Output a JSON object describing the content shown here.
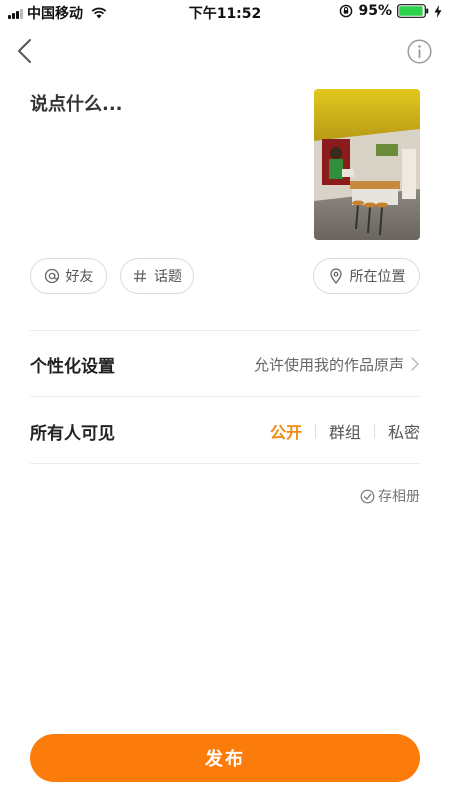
{
  "status_bar": {
    "carrier": "中国移动",
    "time": "下午11:52",
    "battery_percent": "95%",
    "battery_level": 0.95
  },
  "nav": {
    "back_icon": "chevron-left-icon",
    "info_icon": "info-icon"
  },
  "compose": {
    "placeholder": "说点什么...",
    "cover_image": "cafe-interior-photo"
  },
  "chips": {
    "friends": "好友",
    "topic": "话题",
    "location": "所在位置"
  },
  "settings": {
    "personalize_label": "个性化设置",
    "personalize_value": "允许使用我的作品原声",
    "visibility_label": "所有人可见",
    "visibility_options": [
      "公开",
      "群组",
      "私密"
    ],
    "visibility_selected": "公开"
  },
  "album_link": "存相册",
  "publish_label": "发布",
  "colors": {
    "accent": "#fb7c0a",
    "selected_text": "#ef8a12"
  }
}
